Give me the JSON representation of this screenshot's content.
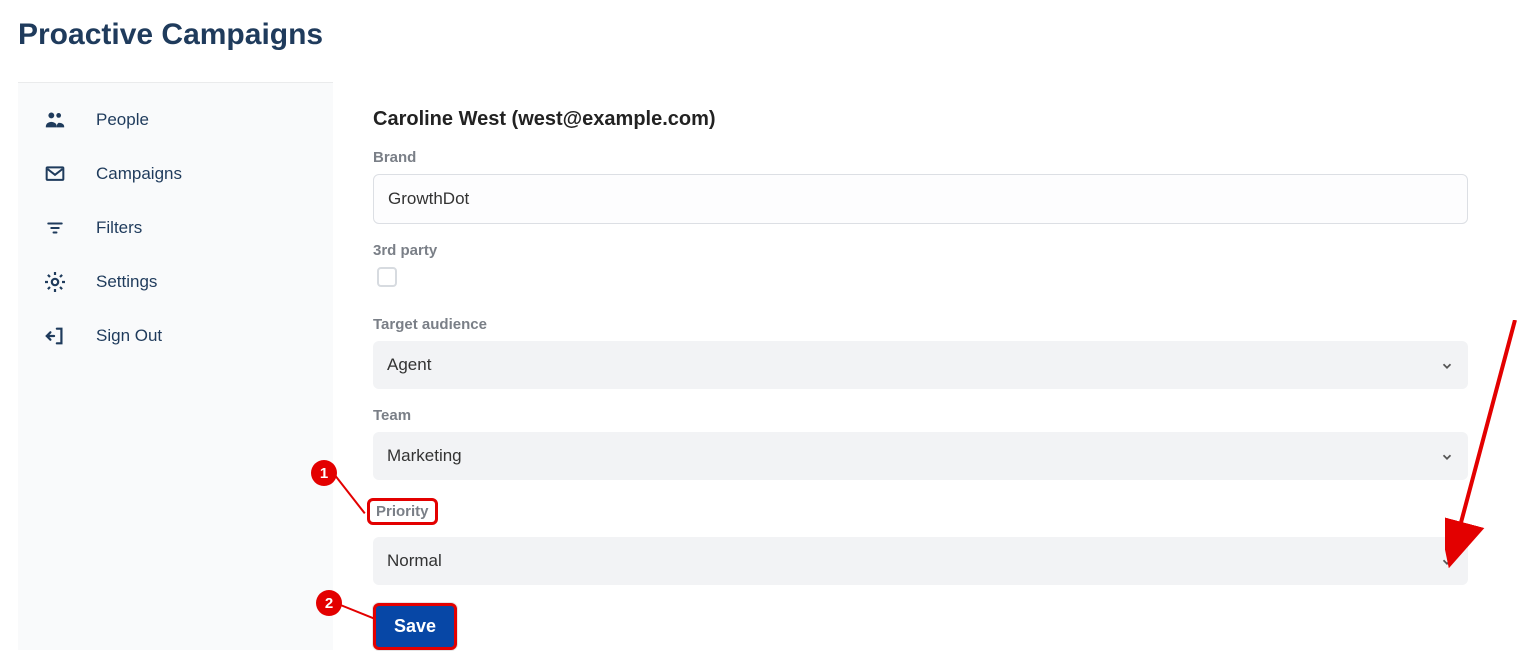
{
  "page": {
    "title": "Proactive Campaigns"
  },
  "sidebar": {
    "items": [
      {
        "label": "People"
      },
      {
        "label": "Campaigns"
      },
      {
        "label": "Filters"
      },
      {
        "label": "Settings"
      },
      {
        "label": "Sign Out"
      }
    ]
  },
  "main": {
    "person_name": "Caroline West (west@example.com)",
    "brand_label": "Brand",
    "brand_value": "GrowthDot",
    "third_party_label": "3rd party",
    "third_party_checked": false,
    "target_audience_label": "Target audience",
    "target_audience_value": "Agent",
    "team_label": "Team",
    "team_value": "Marketing",
    "priority_label": "Priority",
    "priority_value": "Normal",
    "save_label": "Save"
  },
  "annotations": {
    "callout1": "1",
    "callout2": "2"
  }
}
